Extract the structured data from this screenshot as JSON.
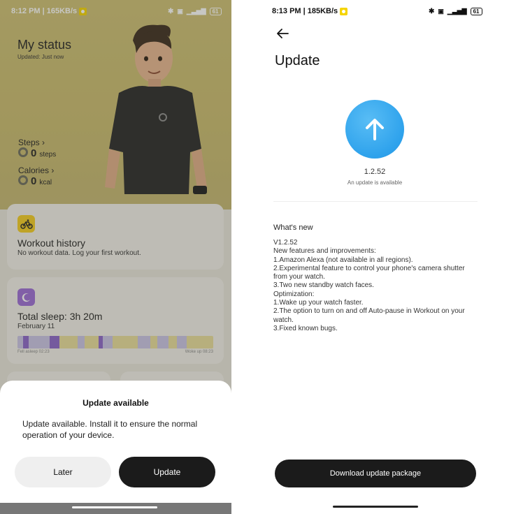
{
  "left": {
    "statusbar": {
      "time_speed": "8:12 PM | 165KB/s",
      "battery": "61"
    },
    "status": {
      "title": "My status",
      "updated": "Updated: Just now"
    },
    "steps": {
      "label": "Steps",
      "chevron": "›",
      "value": "0",
      "unit": "steps"
    },
    "calories": {
      "label": "Calories",
      "chevron": "›",
      "value": "0",
      "unit": "kcal"
    },
    "workout": {
      "title": "Workout history",
      "subtitle": "No workout data. Log your first workout.",
      "icon": "bike-icon",
      "accent": "#f4cc1f"
    },
    "sleep": {
      "title": "Total sleep: 3h 20m",
      "date": "February 11",
      "fell_asleep": "Fell asleep 02:23",
      "woke_up": "Woke up 08:23",
      "icon": "moon-icon",
      "accent": "#9b6ad6"
    },
    "dialog": {
      "title": "Update available",
      "message": "Update available. Install it to ensure the normal operation of your device.",
      "later_label": "Later",
      "update_label": "Update"
    }
  },
  "right": {
    "statusbar": {
      "time_speed": "8:13 PM | 185KB/s",
      "battery": "61"
    },
    "title": "Update",
    "version": "1.2.52",
    "availability": "An update is available",
    "whats_new_heading": "What's new",
    "notes": [
      "V1.2.52",
      "New features and improvements:",
      "1.Amazon Alexa (not available in all regions).",
      "2.Experimental feature to control your phone's camera shutter from your watch.",
      "3.Two new standby watch faces.",
      "Optimization:",
      "1.Wake up your watch faster.",
      "2.The option to turn on and off Auto-pause in Workout on your watch.",
      "3.Fixed known bugs."
    ],
    "download_label": "Download update package",
    "accent": "#2ea2ec"
  }
}
